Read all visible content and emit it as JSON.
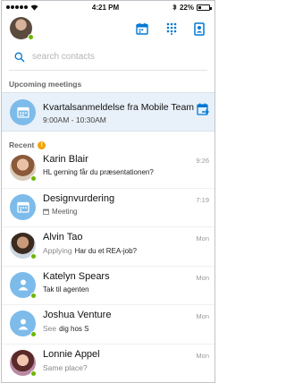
{
  "status_bar": {
    "time": "4:21 PM",
    "battery": "22%",
    "battery_level": 0.22
  },
  "header": {
    "avatar_icon": "user-avatar",
    "icons": [
      "meeting-calendar-icon",
      "dialpad-icon",
      "contacts-icon"
    ],
    "accent_color": "#0078d4"
  },
  "search": {
    "placeholder": "search contacts"
  },
  "upcoming": {
    "title": "Upcoming meetings",
    "meeting": {
      "title": "Kvartalsanmeldelse fra Mobile Team",
      "time": "9:00AM - 10:30AM"
    }
  },
  "recent": {
    "title": "Recent",
    "badge": "!",
    "items": [
      {
        "name": "Karin Blair",
        "mood": "",
        "message": "HL gerning får du præsentationen?",
        "time": "9:26"
      },
      {
        "name": "Designvurdering",
        "mood": "",
        "message": "Meeting",
        "time": "7:19"
      },
      {
        "name": "Alvin Tao",
        "mood": "Applying",
        "message": "Har du et REA-job?",
        "time": "Mon"
      },
      {
        "name": "Katelyn Spears",
        "mood": "",
        "message": "Tak til agenten",
        "time": "Mon"
      },
      {
        "name": "Joshua Venture",
        "mood": "See",
        "message": "dig hos S",
        "time": "Mon"
      },
      {
        "name": "Lonnie Appel",
        "mood": "Same place?",
        "message": "",
        "time": "Mon"
      }
    ]
  }
}
